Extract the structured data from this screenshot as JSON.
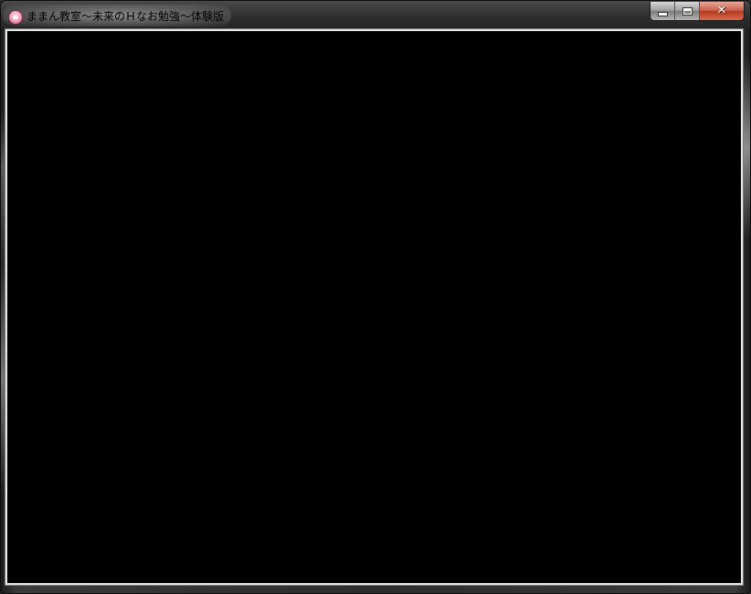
{
  "window": {
    "title": "ままん教室～未来のＨなお勉強～体験版",
    "icon": "app-character-icon",
    "close_symbol": "✕"
  },
  "caption_buttons": {
    "minimize": "minimize-icon",
    "maximize": "maximize-icon",
    "close": "close-icon"
  },
  "client": {
    "background": "#000000"
  }
}
